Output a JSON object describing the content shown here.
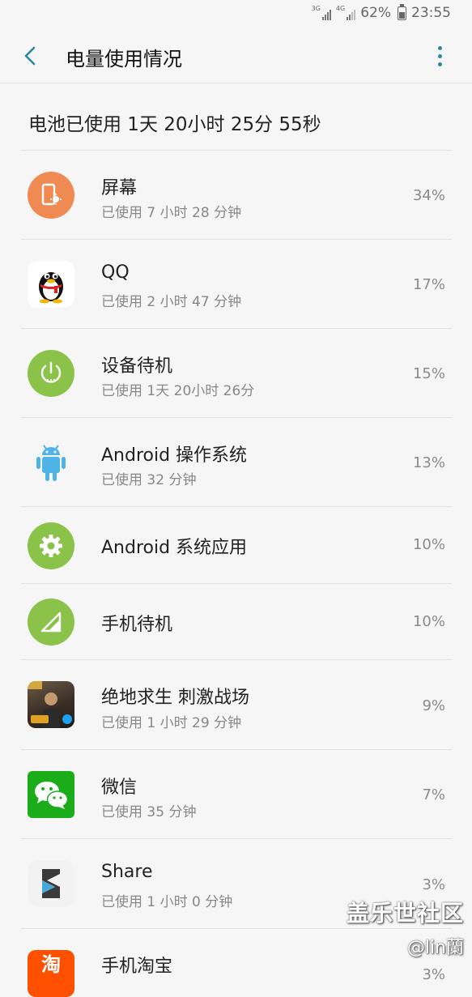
{
  "status_bar": {
    "net1": "3G",
    "net2": "4G",
    "battery": "62%",
    "time": "23:55"
  },
  "app_bar": {
    "title": "电量使用情况"
  },
  "summary": "电池已使用 1天 20小时 25分 55秒",
  "items": [
    {
      "name": "屏幕",
      "usage": "已使用 7 小时 28 分钟",
      "percent": "34%",
      "icon": "screen-icon",
      "color": "#ef8a52"
    },
    {
      "name": "QQ",
      "usage": "已使用 2 小时 47 分钟",
      "percent": "17%",
      "icon": "qq-penguin-icon",
      "color": "#ffffff"
    },
    {
      "name": "设备待机",
      "usage": "已使用 1天 20小时 26分",
      "percent": "15%",
      "icon": "power-standby-icon",
      "color": "#8bc34a"
    },
    {
      "name": "Android 操作系统",
      "usage": "已使用 32 分钟",
      "percent": "13%",
      "icon": "android-robot-icon",
      "color": "#4fb3e8"
    },
    {
      "name": "Android 系统应用",
      "usage": "",
      "percent": "10%",
      "icon": "gear-icon",
      "color": "#8bc34a"
    },
    {
      "name": "手机待机",
      "usage": "",
      "percent": "10%",
      "icon": "signal-icon",
      "color": "#8bc34a"
    },
    {
      "name": "绝地求生 刺激战场",
      "usage": "已使用 1 小时 29 分钟",
      "percent": "9%",
      "icon": "pubg-game-icon",
      "color": "#3a2e25"
    },
    {
      "name": "微信",
      "usage": "已使用 35 分钟",
      "percent": "7%",
      "icon": "wechat-icon",
      "color": "#1aad19"
    },
    {
      "name": "Share",
      "usage": "已使用 1 小时 0 分钟",
      "percent": "3%",
      "icon": "share-app-icon",
      "color": "#f2f2f2"
    },
    {
      "name": "手机淘宝",
      "usage": "",
      "percent": "3%",
      "icon": "taobao-icon",
      "color": "#ff5000"
    }
  ],
  "watermark": {
    "site": "盖乐世社区",
    "user": "@lin蘭"
  }
}
